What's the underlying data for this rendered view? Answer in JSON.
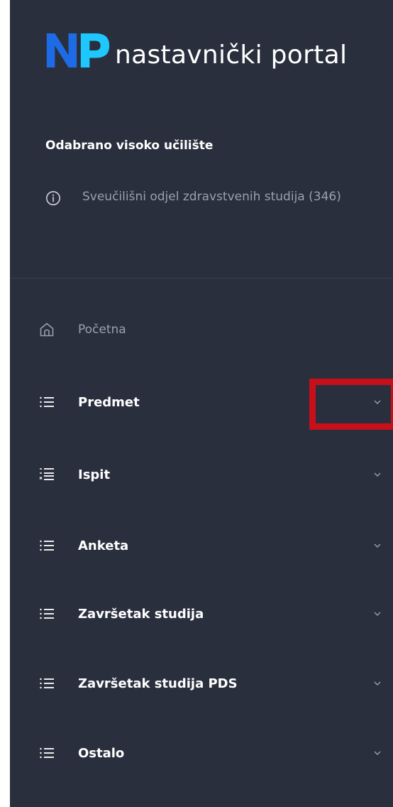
{
  "brand": {
    "logo_text": "nastavnički portal",
    "colors": {
      "logo_n": "#1e6be6",
      "logo_p": "#1ec8ff",
      "sidebar_bg": "#2a2f3e",
      "highlight": "#c8101a"
    }
  },
  "institution": {
    "heading": "Odabrano visoko učilište",
    "name": "Sveučilišni odjel zdravstvenih studija (346)",
    "icon": "info-icon"
  },
  "nav": {
    "home": {
      "label": "Početna",
      "icon": "home-icon"
    },
    "items": [
      {
        "label": "Predmet",
        "icon": "list-icon",
        "chevron": "chevron-down-icon"
      },
      {
        "label": "Ispit",
        "icon": "checklist-icon",
        "chevron": "chevron-down-icon"
      },
      {
        "label": "Anketa",
        "icon": "list-icon",
        "chevron": "chevron-down-icon"
      },
      {
        "label": "Završetak studija",
        "icon": "list-icon",
        "chevron": "chevron-down-icon"
      },
      {
        "label": "Završetak studija PDS",
        "icon": "list-icon",
        "chevron": "chevron-down-icon"
      },
      {
        "label": "Ostalo",
        "icon": "list-icon",
        "chevron": "chevron-down-icon"
      }
    ]
  }
}
